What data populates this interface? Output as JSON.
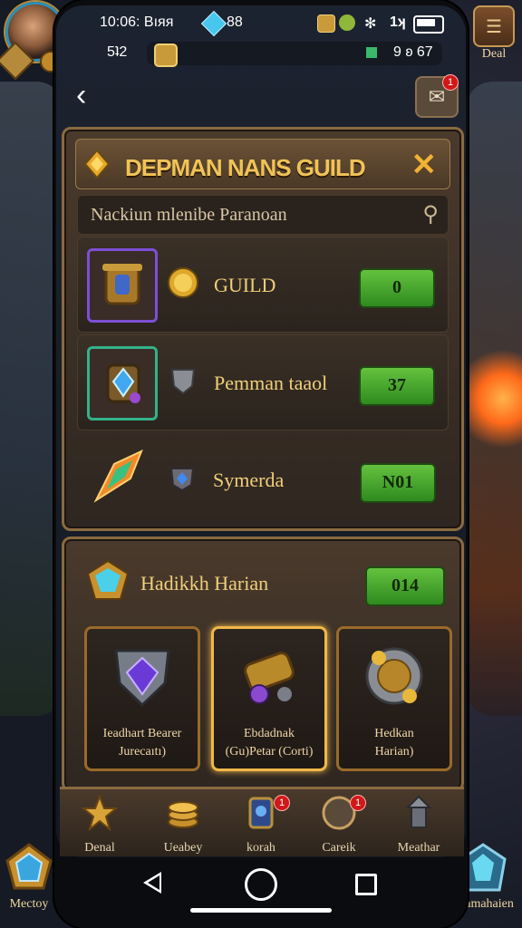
{
  "status_bar": {
    "time": "10:06: Bıяя",
    "gem_count": "88",
    "signal": "1ʞ"
  },
  "resources": {
    "left_value": "5ʇ2",
    "right_value": "9 ʚ 67"
  },
  "top_right": {
    "label": "Deal"
  },
  "panel1": {
    "title": "DEPMAN NANS GUILD",
    "search_placeholder": "Nackiun mlenibe Paranoan",
    "rows": [
      {
        "label": "GUILD",
        "button": "0"
      },
      {
        "label": "Pemman taaol",
        "button": "37"
      },
      {
        "label": "Symerda",
        "button": "N01"
      }
    ]
  },
  "panel2": {
    "title": "Hadikkh Harian",
    "button": "014",
    "cards": [
      {
        "line1": "Ieadhart Bearer",
        "line2": "Jurecaıtı)"
      },
      {
        "line1": "Ebdadnak",
        "line2": "(Gu)Petar (Corti)"
      },
      {
        "line1": "Hedkan",
        "line2": "Harian)"
      }
    ]
  },
  "nav": [
    {
      "label": "Denal"
    },
    {
      "label": "Ueabey"
    },
    {
      "label": "korah"
    },
    {
      "label": "Careik"
    },
    {
      "label": "Meathar"
    }
  ],
  "outside": {
    "bottom_left": "Mectoy",
    "bottom_right": "Rlamahaien"
  },
  "colors": {
    "gold": "#f0c357",
    "green_button": "#4caa2e",
    "panel_border": "#8a6a40",
    "notification": "#d01818"
  },
  "badges": {
    "mail": "1",
    "nav_korah": "1",
    "nav_careik": "1"
  }
}
